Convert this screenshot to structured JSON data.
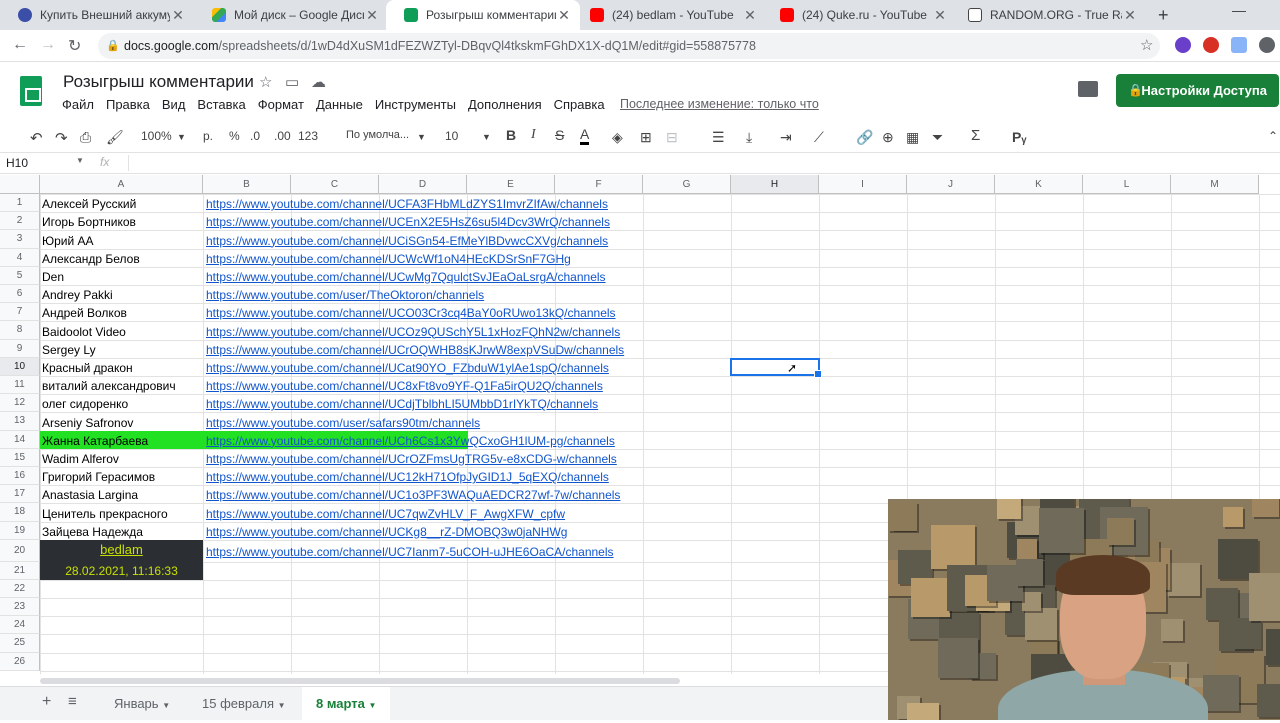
{
  "browser": {
    "tabs": [
      {
        "title": "Купить Внешний аккумулятор",
        "favicon": "github-like-icon",
        "color": "#1a73e8",
        "active": false
      },
      {
        "title": "Мой диск – Google Диск",
        "favicon": "google-drive-icon",
        "color": "#fbbc04",
        "active": false
      },
      {
        "title": "Розыгрыш комментарии - Goo",
        "favicon": "google-sheets-icon",
        "color": "#0f9d58",
        "active": true
      },
      {
        "title": "(24) bedlam - YouTube",
        "favicon": "youtube-icon",
        "color": "#ff0000",
        "active": false
      },
      {
        "title": "(24) Quke.ru - YouTube",
        "favicon": "youtube-icon",
        "color": "#ff0000",
        "active": false
      },
      {
        "title": "RANDOM.ORG - True Random",
        "favicon": "random-org-icon",
        "color": "#444444",
        "active": false
      }
    ],
    "url_prefix": "docs.google.com",
    "url_rest": "/spreadsheets/d/1wD4dXuSM1dFEZWZTyl-DBqvQl4tkskmFGhDX1X-dQ1M/edit#gid=558875778"
  },
  "doc": {
    "title": "Розыгрыш комментарии",
    "menu": [
      "Файл",
      "Правка",
      "Вид",
      "Вставка",
      "Формат",
      "Данные",
      "Инструменты",
      "Дополнения",
      "Справка"
    ],
    "last_edit": "Последнее изменение: только что",
    "share_label": "Настройки Доступа"
  },
  "toolbar": {
    "zoom": "100%",
    "currency": "р.",
    "percent": "%",
    "dec_decrease": ".0",
    "dec_increase": ".00",
    "number_format": "123",
    "font": "По умолча...",
    "font_size": "10",
    "bold": "B",
    "italic": "I",
    "strike": "S",
    "text_color": "A",
    "sum": "Σ"
  },
  "formula_bar": {
    "cell_ref": "H10",
    "fx": "fx"
  },
  "sheet": {
    "columns": [
      "A",
      "B",
      "C",
      "D",
      "E",
      "F",
      "G",
      "H",
      "I",
      "J",
      "K",
      "L",
      "M"
    ],
    "selected_column": "H",
    "selected_row": 10,
    "row_numbers": [
      "1",
      "2",
      "3",
      "4",
      "5",
      "6",
      "7",
      "8",
      "9",
      "10",
      "11",
      "12",
      "13",
      "14",
      "15",
      "16",
      "17",
      "18",
      "19",
      "20",
      "21",
      "22",
      "23",
      "24",
      "25",
      "26"
    ],
    "rows": [
      {
        "name": "Алексей Русский",
        "link": "https://www.youtube.com/channel/UCFA3FHbMLdZYS1ImvrZIfAw/channels"
      },
      {
        "name": "Игорь Бортников",
        "link": "https://www.youtube.com/channel/UCEnX2E5HsZ6su5l4Dcv3WrQ/channels"
      },
      {
        "name": "Юрий АА",
        "link": "https://www.youtube.com/channel/UCiSGn54-EfMeYlBDvwcCXVg/channels"
      },
      {
        "name": "Александр Белов",
        "link": "https://www.youtube.com/channel/UCWcWf1oN4HEcKDSrSnF7GHg"
      },
      {
        "name": "Den",
        "link": "https://www.youtube.com/channel/UCwMg7QqulctSvJEaOaLsrgA/channels"
      },
      {
        "name": "Andrey Pakki",
        "link": "https://www.youtube.com/user/TheOktoron/channels"
      },
      {
        "name": "Андрей Волков",
        "link": "https://www.youtube.com/channel/UCO03Cr3cq4BaY0oRUwo13kQ/channels"
      },
      {
        "name": "Baidoolot Video",
        "link": "https://www.youtube.com/channel/UCOz9QUSchY5L1xHozFQhN2w/channels"
      },
      {
        "name": "Sergey Ly",
        "link": "https://www.youtube.com/channel/UCrOQWHB8sKJrwW8expVSuDw/channels"
      },
      {
        "name": "Красный дракон",
        "link": "https://www.youtube.com/channel/UCat90YO_FZbduW1ylAe1spQ/channels"
      },
      {
        "name": "виталий александрович",
        "link": "https://www.youtube.com/channel/UC8xFt8vo9YF-Q1Fa5irQU2Q/channels"
      },
      {
        "name": "олег сидоренко",
        "link": "https://www.youtube.com/channel/UCdjTblbhLI5UMbbD1rIYkTQ/channels"
      },
      {
        "name": "Arseniy Safronov",
        "link": "https://www.youtube.com/user/safars90tm/channels"
      },
      {
        "name": "Жанна Катарбаева",
        "link": "https://www.youtube.com/channel/UCh6Cs1x3YwQCxoGH1lUM-pg/channels"
      },
      {
        "name": "Wadim Alferov",
        "link": "https://www.youtube.com/channel/UCrOZFmsUgTRG5v-e8xCDG-w/channels"
      },
      {
        "name": "Григорий Герасимов",
        "link": "https://www.youtube.com/channel/UC12kH71OfpJyGID1J_5qEXQ/channels"
      },
      {
        "name": "Anastasia Largina",
        "link": "https://www.youtube.com/channel/UC1o3PF3WAQuAEDCR27wf-7w/channels"
      },
      {
        "name": "Ценитель прекрасного",
        "link": "https://www.youtube.com/channel/UC7qwZvHLV_F_AwgXFW_cpfw"
      },
      {
        "name": "Зайцева Надежда",
        "link": "https://www.youtube.com/channel/UCKg8__rZ-DMOBQ3w0jaNHWg"
      },
      {
        "name": "",
        "link": "https://www.youtube.com/channel/UC7Ianm7-5uCOH-uJHE6OaCA/channels"
      }
    ],
    "highlight_row": 14,
    "highlight_color": "#22e022",
    "overlay_name": "bedlam",
    "overlay_time": "28.02.2021, 11:16:33"
  },
  "sheet_tabs": {
    "add": "+",
    "list": "≡",
    "tabs": [
      "Январь",
      "15 февраля",
      "8 марта"
    ],
    "active": "8 марта"
  },
  "colors": {
    "accent_green": "#188038",
    "link_blue": "#1155cc",
    "selection_blue": "#1a73e8"
  }
}
